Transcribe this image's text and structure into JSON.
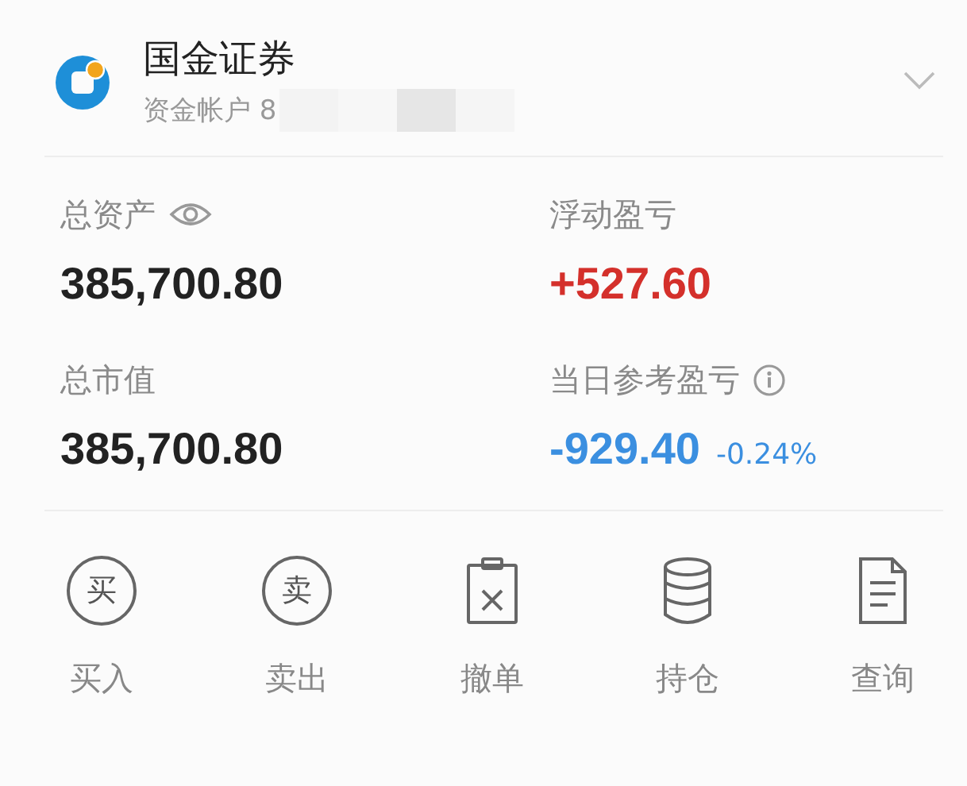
{
  "header": {
    "broker": "国金证券",
    "account_label": "资金帐户 8",
    "account_masked": true,
    "expandable": true
  },
  "stats": [
    {
      "kind": "eye",
      "label": "总资产",
      "value": "385,700.80",
      "color": "#222222"
    },
    {
      "kind": "plain",
      "label": "浮动盈亏",
      "value": "+527.60",
      "color": "#d4302b"
    },
    {
      "kind": "plain",
      "label": "总市值",
      "value": "385,700.80",
      "color": "#222222"
    },
    {
      "kind": "info",
      "label": "当日参考盈亏",
      "value": "-929.40",
      "color": "#3b8fe0",
      "change": "-0.24%"
    }
  ],
  "actions": [
    {
      "kind": "glyph",
      "glyph": "买",
      "label": "买入"
    },
    {
      "kind": "glyph",
      "glyph": "卖",
      "label": "卖出"
    },
    {
      "kind": "cancel",
      "label": "撤单"
    },
    {
      "kind": "holdings",
      "label": "持仓"
    },
    {
      "kind": "query",
      "label": "查询"
    }
  ]
}
